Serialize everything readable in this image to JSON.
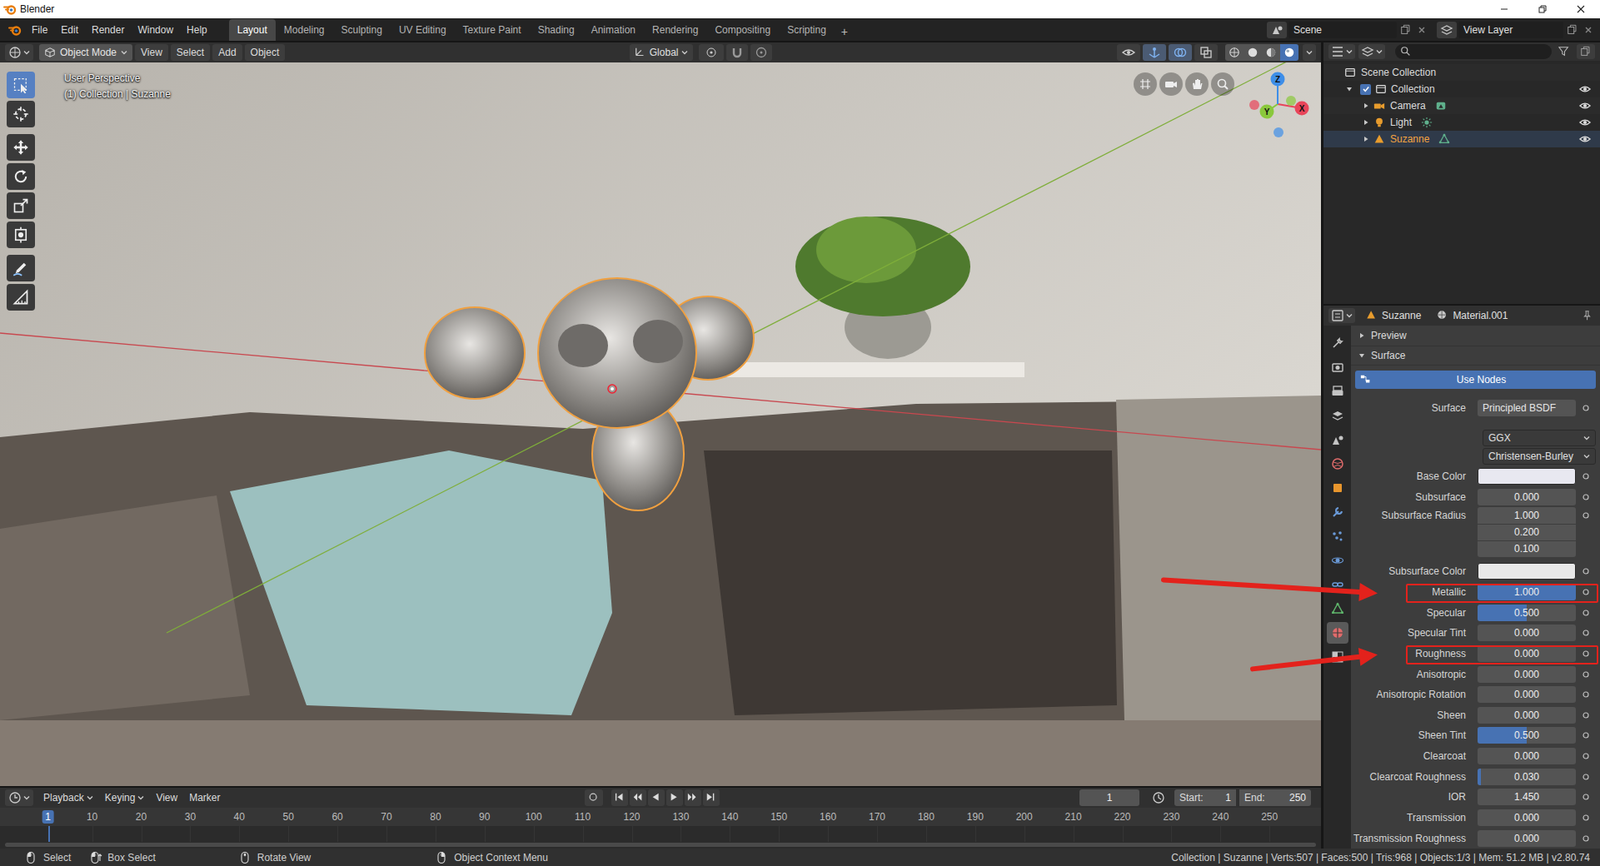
{
  "window": {
    "title": "Blender"
  },
  "menu": [
    "File",
    "Edit",
    "Render",
    "Window",
    "Help"
  ],
  "workspaces": [
    {
      "label": "Layout",
      "selected": true
    },
    {
      "label": "Modeling",
      "selected": false
    },
    {
      "label": "Sculpting",
      "selected": false
    },
    {
      "label": "UV Editing",
      "selected": false
    },
    {
      "label": "Texture Paint",
      "selected": false
    },
    {
      "label": "Shading",
      "selected": false
    },
    {
      "label": "Animation",
      "selected": false
    },
    {
      "label": "Rendering",
      "selected": false
    },
    {
      "label": "Compositing",
      "selected": false
    },
    {
      "label": "Scripting",
      "selected": false
    }
  ],
  "add_workspace": "+",
  "scene": "Scene",
  "view_layer": "View Layer",
  "viewport": {
    "mode": "Object Mode",
    "menus": [
      "View",
      "Select",
      "Add",
      "Object"
    ],
    "orientation": "Global",
    "perspective": "User Perspective",
    "context": "(1) Collection | Suzanne",
    "tools": [
      {
        "kind": "select",
        "selected": true
      },
      {
        "kind": "cursor",
        "selected": false
      },
      {
        "kind": "move",
        "selected": false
      },
      {
        "kind": "rotate",
        "selected": false
      },
      {
        "kind": "scale",
        "selected": false
      },
      {
        "kind": "transform",
        "selected": false
      },
      {
        "kind": "annotate",
        "selected": false
      },
      {
        "kind": "measure",
        "selected": false
      }
    ],
    "toggles": [
      {
        "kind": "visibility",
        "on": false
      },
      {
        "kind": "gizmos",
        "on": true
      },
      {
        "kind": "overlays",
        "on": true
      },
      {
        "kind": "xray",
        "on": false
      }
    ],
    "shading": [
      {
        "kind": "wireframe",
        "selected": false
      },
      {
        "kind": "solid",
        "selected": false
      },
      {
        "kind": "material",
        "selected": false
      },
      {
        "kind": "rendered",
        "selected": true
      }
    ],
    "gizmo": [
      {
        "axis": "X",
        "color": "#e8455a"
      },
      {
        "axis": "Y",
        "color": "#8ac83c"
      },
      {
        "axis": "Z",
        "color": "#3e8ee8"
      }
    ]
  },
  "outliner": {
    "root": "Scene Collection",
    "collection": {
      "label": "Collection",
      "expanded": true,
      "checked": true,
      "visible": true
    },
    "objects": [
      {
        "label": "Camera",
        "kind": "camera",
        "expanded": false,
        "selected": false,
        "visible": true
      },
      {
        "label": "Light",
        "kind": "light",
        "expanded": false,
        "selected": false,
        "visible": true
      },
      {
        "label": "Suzanne",
        "kind": "mesh",
        "expanded": false,
        "selected": true,
        "visible": true
      }
    ]
  },
  "properties": {
    "object": "Suzanne",
    "material": "Material.001",
    "tabs": [
      {
        "kind": "tool",
        "color": "#c4c4c4",
        "selected": false
      },
      {
        "kind": "render",
        "color": "#c4c4c4",
        "selected": false
      },
      {
        "kind": "output",
        "color": "#c4c4c4",
        "selected": false
      },
      {
        "kind": "view_layer",
        "color": "#c4c4c4",
        "selected": false
      },
      {
        "kind": "scene",
        "color": "#c4c4c4",
        "selected": false
      },
      {
        "kind": "world",
        "color": "#e06b6b",
        "selected": false
      },
      {
        "kind": "object",
        "color": "#e8962d",
        "selected": false
      },
      {
        "kind": "modifier",
        "color": "#6a9ad8",
        "selected": false
      },
      {
        "kind": "particles",
        "color": "#6a9ad8",
        "selected": false
      },
      {
        "kind": "physics",
        "color": "#6a9ad8",
        "selected": false
      },
      {
        "kind": "constraints",
        "color": "#6a9ad8",
        "selected": false
      },
      {
        "kind": "data",
        "color": "#5fb56b",
        "selected": false
      },
      {
        "kind": "material",
        "color": "#e06b6b",
        "selected": true
      },
      {
        "kind": "texture",
        "color": "#c4c4c4",
        "selected": false
      }
    ],
    "panels": [
      {
        "label": "Preview",
        "expanded": false
      },
      {
        "label": "Surface",
        "expanded": true
      }
    ],
    "use_nodes": "Use Nodes",
    "surface_label": "Surface",
    "surface_value": "Principled BSDF",
    "distribution": "GGX",
    "subsurface_method": "Christensen-Burley",
    "fields": [
      {
        "label": "Base Color",
        "kind": "color",
        "color": "#e8e8f0",
        "annotated": false
      },
      {
        "label": "Subsurface",
        "kind": "slider",
        "value": "0.000",
        "level": 0,
        "annotated": false
      },
      {
        "label": "Subsurface Radius",
        "kind": "vector",
        "values": [
          "1.000",
          "0.200",
          "0.100"
        ],
        "annotated": false
      },
      {
        "label": "Subsurface Color",
        "kind": "color",
        "color": "#e8e8e8",
        "annotated": false
      },
      {
        "label": "Metallic",
        "kind": "slider",
        "value": "1.000",
        "level": 1,
        "annotated": true
      },
      {
        "label": "Specular",
        "kind": "slider",
        "value": "0.500",
        "level": 0.5,
        "annotated": false
      },
      {
        "label": "Specular Tint",
        "kind": "slider",
        "value": "0.000",
        "level": 0,
        "annotated": false
      },
      {
        "label": "Roughness",
        "kind": "slider",
        "value": "0.000",
        "level": 0,
        "annotated": true
      },
      {
        "label": "Anisotropic",
        "kind": "slider",
        "value": "0.000",
        "level": 0,
        "annotated": false
      },
      {
        "label": "Anisotropic Rotation",
        "kind": "slider",
        "value": "0.000",
        "level": 0,
        "annotated": false
      },
      {
        "label": "Sheen",
        "kind": "slider",
        "value": "0.000",
        "level": 0,
        "annotated": false
      },
      {
        "label": "Sheen Tint",
        "kind": "slider",
        "value": "0.500",
        "level": 0.5,
        "annotated": false
      },
      {
        "label": "Clearcoat",
        "kind": "slider",
        "value": "0.000",
        "level": 0,
        "annotated": false
      },
      {
        "label": "Clearcoat Roughness",
        "kind": "slider",
        "value": "0.030",
        "level": 0.03,
        "annotated": false
      },
      {
        "label": "IOR",
        "kind": "number",
        "value": "1.450",
        "annotated": false
      },
      {
        "label": "Transmission",
        "kind": "slider",
        "value": "0.000",
        "level": 0,
        "annotated": false
      },
      {
        "label": "Transmission Roughness",
        "kind": "slider",
        "value": "0.000",
        "level": 0,
        "annotated": false
      }
    ]
  },
  "timeline": {
    "menus": [
      "Playback",
      "Keying",
      "View",
      "Marker"
    ],
    "frame": "1",
    "start_label": "Start:",
    "start": "1",
    "end_label": "End:",
    "end": "250",
    "ruler": [
      {
        "label": "1",
        "selected": true
      },
      {
        "label": "10",
        "selected": false
      },
      {
        "label": "20",
        "selected": false
      },
      {
        "label": "30",
        "selected": false
      },
      {
        "label": "40",
        "selected": false
      },
      {
        "label": "50",
        "selected": false
      },
      {
        "label": "60",
        "selected": false
      },
      {
        "label": "70",
        "selected": false
      },
      {
        "label": "80",
        "selected": false
      },
      {
        "label": "90",
        "selected": false
      },
      {
        "label": "100",
        "selected": false
      },
      {
        "label": "110",
        "selected": false
      },
      {
        "label": "120",
        "selected": false
      },
      {
        "label": "130",
        "selected": false
      },
      {
        "label": "140",
        "selected": false
      },
      {
        "label": "150",
        "selected": false
      },
      {
        "label": "160",
        "selected": false
      },
      {
        "label": "170",
        "selected": false
      },
      {
        "label": "180",
        "selected": false
      },
      {
        "label": "190",
        "selected": false
      },
      {
        "label": "200",
        "selected": false
      },
      {
        "label": "210",
        "selected": false
      },
      {
        "label": "220",
        "selected": false
      },
      {
        "label": "230",
        "selected": false
      },
      {
        "label": "240",
        "selected": false
      },
      {
        "label": "250",
        "selected": false
      }
    ]
  },
  "status_bar": {
    "hints": [
      {
        "label": "Select",
        "kind": "left"
      },
      {
        "label": "Box Select",
        "kind": "drag"
      },
      {
        "label": "Rotate View",
        "kind": "middle"
      },
      {
        "label": "Object Context Menu",
        "kind": "right"
      }
    ],
    "info": "Collection | Suzanne | Verts:507 | Faces:500 | Tris:968 | Objects:1/3 | Mem: 51.2 MB | v2.80.74"
  }
}
